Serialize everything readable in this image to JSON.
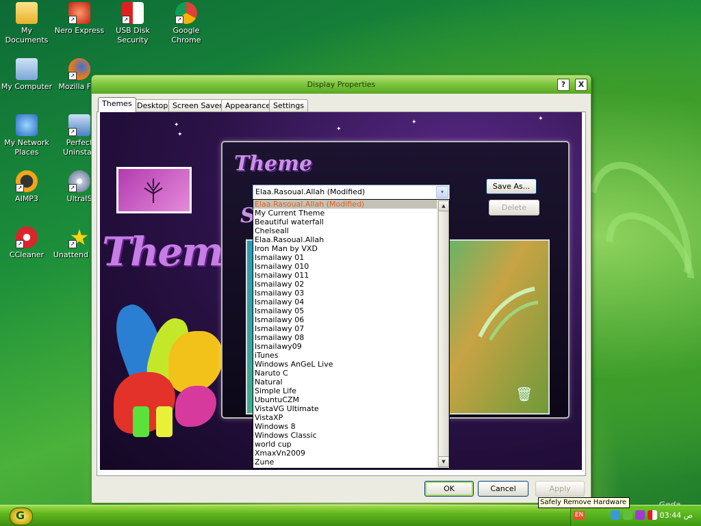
{
  "desktop": {
    "icons": [
      {
        "label": "My Documents"
      },
      {
        "label": "Nero Express"
      },
      {
        "label": "USB Disk Security"
      },
      {
        "label": "Google Chrome"
      },
      {
        "label": "My Computer"
      },
      {
        "label": "Mozilla Fire"
      },
      {
        "label": "My Network Places"
      },
      {
        "label": "Perfect Uninstall"
      },
      {
        "label": "AIMP3"
      },
      {
        "label": "UltraIS"
      },
      {
        "label": "CCleaner"
      },
      {
        "label": "Unattend Soft"
      }
    ],
    "watermark": "...Geda Gamall"
  },
  "window": {
    "title": "Display Properties",
    "help_label": "?",
    "close_label": "X",
    "tabs": [
      {
        "label": "Themes"
      },
      {
        "label": "Desktop"
      },
      {
        "label": "Screen Saver"
      },
      {
        "label": "Appearance"
      },
      {
        "label": "Settings"
      }
    ],
    "preview": {
      "themes_word": "Themes",
      "theme_heading": "Theme",
      "s_heading": "S"
    },
    "theme_combo": {
      "value": "Elaa.Rasoual.Allah (Modified)",
      "arrow_glyph": "▾"
    },
    "save_as_label": "Save As...",
    "delete_label": "Delete",
    "dropdown_items": [
      "Elaa.Rasoual.Allah (Modified)",
      "My Current Theme",
      "Beautiful waterfall",
      "Chelseall",
      "Elaa.Rasoual.Allah",
      "Iron Man by VXD",
      "Ismailawy 01",
      "Ismailawy 010",
      "Ismailawy 011",
      "Ismailawy 02",
      "Ismailawy 03",
      "Ismailawy 04",
      "Ismailawy 05",
      "Ismailawy 06",
      "Ismailawy 07",
      "Ismailawy 08",
      "Ismailawy09",
      "iTunes",
      "Windows AnGeL Live",
      "Naruto C",
      "Natural",
      "Simple Life",
      "UbuntuCZM",
      "VistaVG Ultimate",
      "VistaXP",
      "Windows 8",
      "Windows Classic",
      "world cup",
      "XmaxVn2009",
      "Zune"
    ],
    "ok_label": "OK",
    "cancel_label": "Cancel",
    "apply_label": "Apply"
  },
  "taskbar": {
    "language": "EN",
    "clock": "03:44 ص",
    "tooltip": "Safely Remove Hardware"
  },
  "colors": {
    "accent_green": "#5aa724",
    "selection_gray": "#c4c2b6",
    "selection_text": "#e0601a"
  }
}
